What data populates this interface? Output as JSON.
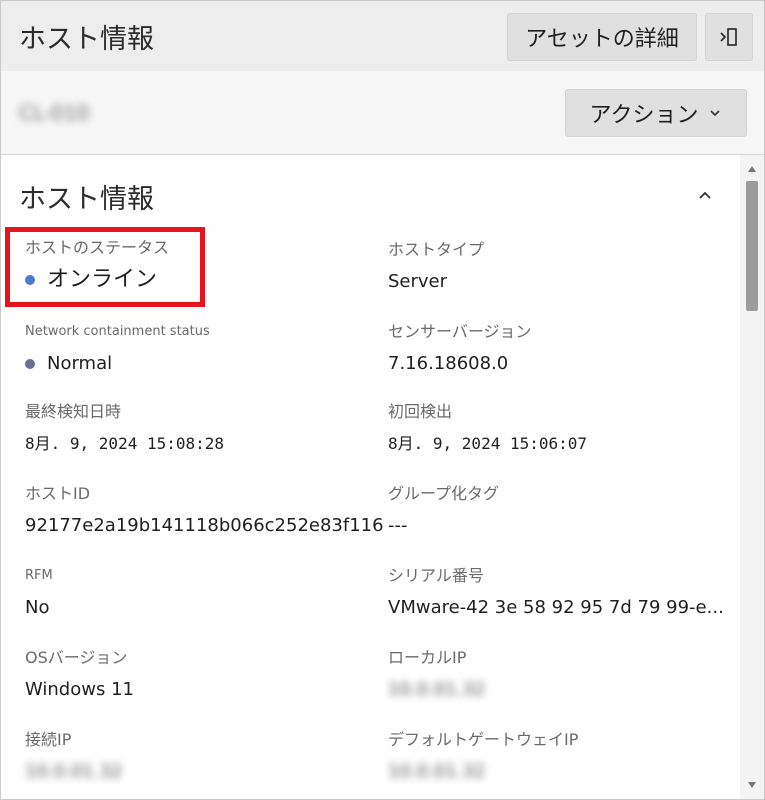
{
  "header": {
    "title": "ホスト情報",
    "asset_details_label": "アセットの詳細"
  },
  "subheader": {
    "hostname": "CL-010",
    "action_label": "アクション"
  },
  "section": {
    "title": "ホスト情報"
  },
  "fields": {
    "host_status": {
      "label": "ホストのステータス",
      "value": "オンライン",
      "dot_color": "#4a7bd0"
    },
    "host_type": {
      "label": "ホストタイプ",
      "value": "Server"
    },
    "network_containment": {
      "label": "Network containment status",
      "value": "Normal",
      "dot_color": "#6a6f99"
    },
    "sensor_version": {
      "label": "センサーバージョン",
      "value": "7.16.18608.0"
    },
    "last_seen": {
      "label": "最終検知日時",
      "value": "8月. 9, 2024 15:08:28"
    },
    "first_seen": {
      "label": "初回検出",
      "value": "8月. 9, 2024 15:06:07"
    },
    "host_id": {
      "label": "ホストID",
      "value": "92177e2a19b141118b066c252e83f116"
    },
    "grouping_tags": {
      "label": "グループ化タグ",
      "value": "---"
    },
    "rfm": {
      "label": "RFM",
      "value": "No"
    },
    "serial_number": {
      "label": "シリアル番号",
      "value": "VMware-42 3e 58 92 95 7d 79 99-e..."
    },
    "os_version": {
      "label": "OSバージョン",
      "value": "Windows 11"
    },
    "local_ip": {
      "label": "ローカルIP",
      "value": "10.0.01.32"
    },
    "connection_ip": {
      "label": "接続IP",
      "value": "10.0.01.32"
    },
    "default_gateway_ip": {
      "label": "デフォルトゲートウェイIP",
      "value": "10.0.01.32"
    }
  },
  "colors": {
    "highlight": "#e8141c",
    "header_bg": "#ededed"
  }
}
